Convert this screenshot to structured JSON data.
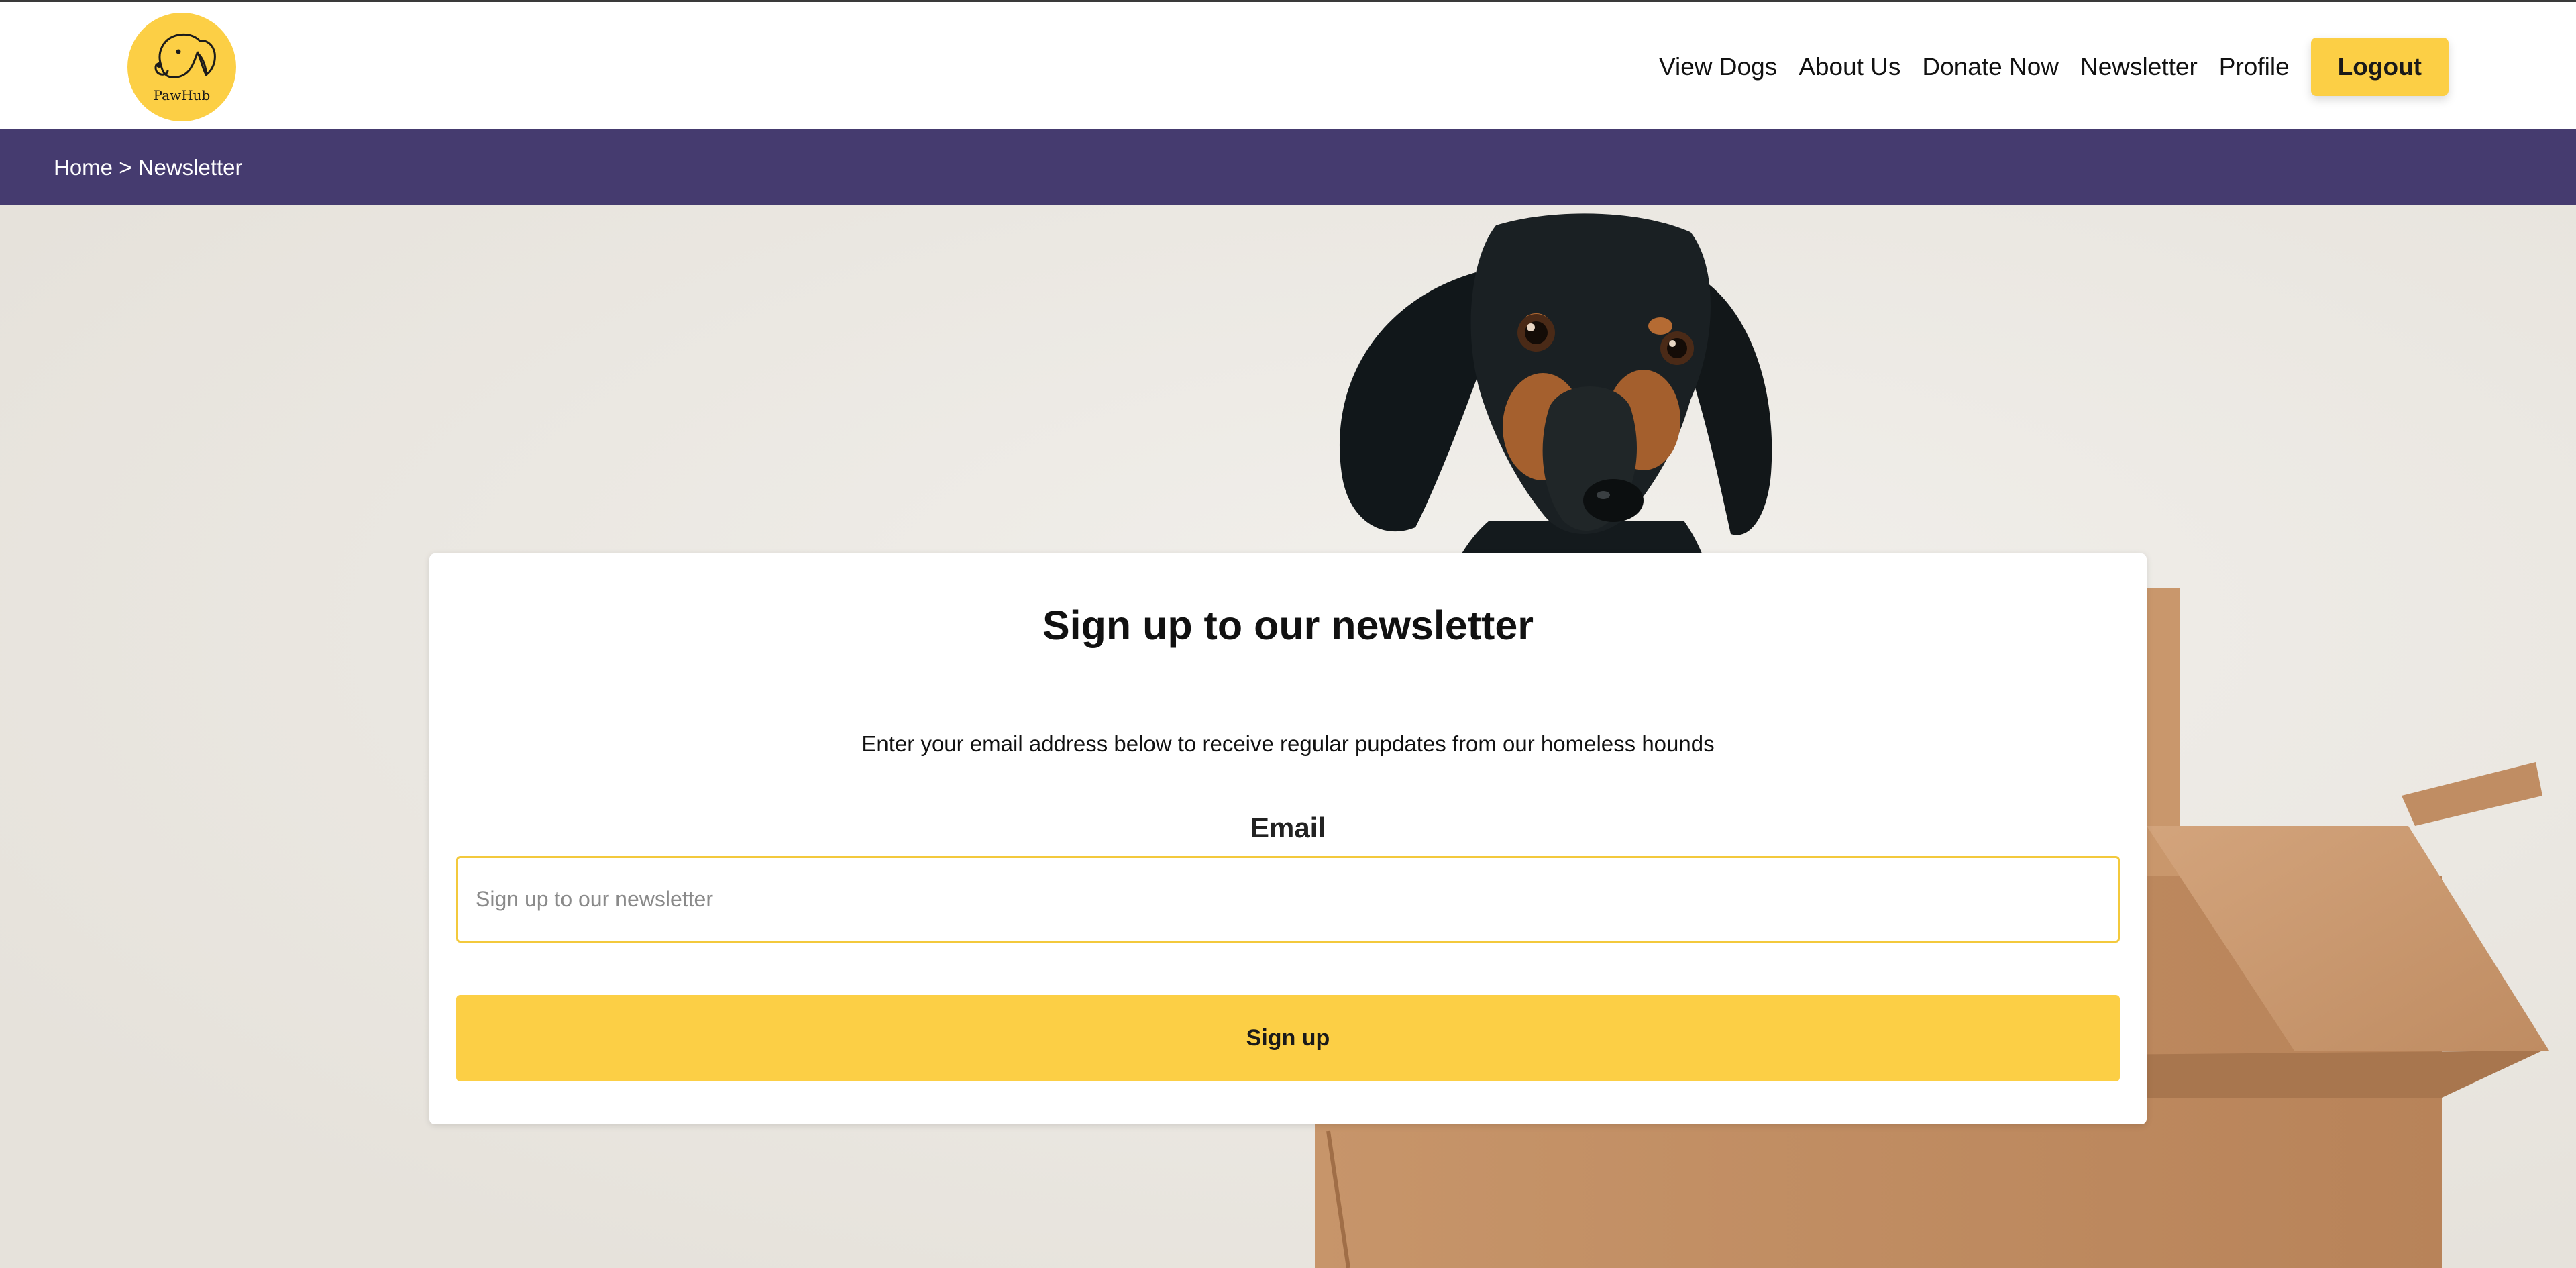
{
  "brand": {
    "logo_text": "PawHub",
    "accent_color": "#fccf45",
    "nav_bar_color": "#453b6f"
  },
  "nav": {
    "links": [
      "View Dogs",
      "About Us",
      "Donate Now",
      "Newsletter",
      "Profile"
    ],
    "logout_label": "Logout"
  },
  "breadcrumb": {
    "text": "Home > Newsletter"
  },
  "hero": {
    "image_subject": "dachshund-in-cardboard-box"
  },
  "newsletter": {
    "title": "Sign up to our newsletter",
    "subtitle": "Enter your email address below to receive regular pupdates from our homeless hounds",
    "email_label": "Email",
    "email_value": "",
    "email_placeholder": "Sign up to our newsletter",
    "submit_label": "Sign up"
  }
}
